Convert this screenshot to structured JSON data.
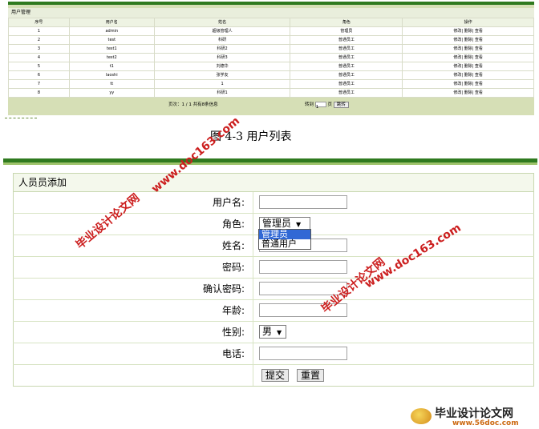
{
  "list": {
    "title": "用户管理",
    "columns": [
      "序号",
      "用户名",
      "姓名",
      "角色",
      "操作"
    ],
    "rows": [
      {
        "no": "1",
        "username": "admin",
        "name": "超级管理人",
        "role": "管理员",
        "ops": "修改| 删除| 查看"
      },
      {
        "no": "2",
        "username": "test",
        "name": "科研",
        "role": "普通员工",
        "ops": "修改| 删除| 查看"
      },
      {
        "no": "3",
        "username": "test1",
        "name": "科研2",
        "role": "普通员工",
        "ops": "修改| 删除| 查看"
      },
      {
        "no": "4",
        "username": "test2",
        "name": "科研3",
        "role": "普通员工",
        "ops": "修改| 删除| 查看"
      },
      {
        "no": "5",
        "username": "t1",
        "name": "刘德华",
        "role": "普通员工",
        "ops": "修改| 删除| 查看"
      },
      {
        "no": "6",
        "username": "laoshi",
        "name": "张学友",
        "role": "普通员工",
        "ops": "修改| 删除| 查看"
      },
      {
        "no": "7",
        "username": "tt",
        "name": "1",
        "role": "普通员工",
        "ops": "修改| 删除| 查看"
      },
      {
        "no": "8",
        "username": "yy",
        "name": "科研1",
        "role": "普通员工",
        "ops": "修改| 删除| 查看"
      }
    ],
    "pager_info": "页次：1 / 1 共有8条信息",
    "jump_label": "转到",
    "page_value": "1",
    "page_unit": "页",
    "jump_button": "跳转"
  },
  "caption": "图 4-3 用户列表",
  "form": {
    "title": "人员员添加",
    "username_label": "用户名:",
    "role_label": "角色:",
    "role_selected": "管理员",
    "role_options": [
      "管理员",
      "普通用户"
    ],
    "name_label": "姓名:",
    "password_label": "密码:",
    "confirm_label": "确认密码:",
    "age_label": "年龄:",
    "gender_label": "性别:",
    "gender_selected": "男",
    "phone_label": "电话:",
    "submit": "提交",
    "reset": "重置"
  },
  "watermarks": {
    "url": "www.doc163.com",
    "cn": "毕业设计论文网"
  },
  "footer": {
    "name": "毕业设计论文网",
    "url": "www.56doc.com"
  },
  "colors": {
    "accent_green": "#2f7a1f",
    "panel_bg": "#d6dfb6",
    "watermark_red": "#cc1f1f",
    "highlight_blue": "#3168d5"
  }
}
